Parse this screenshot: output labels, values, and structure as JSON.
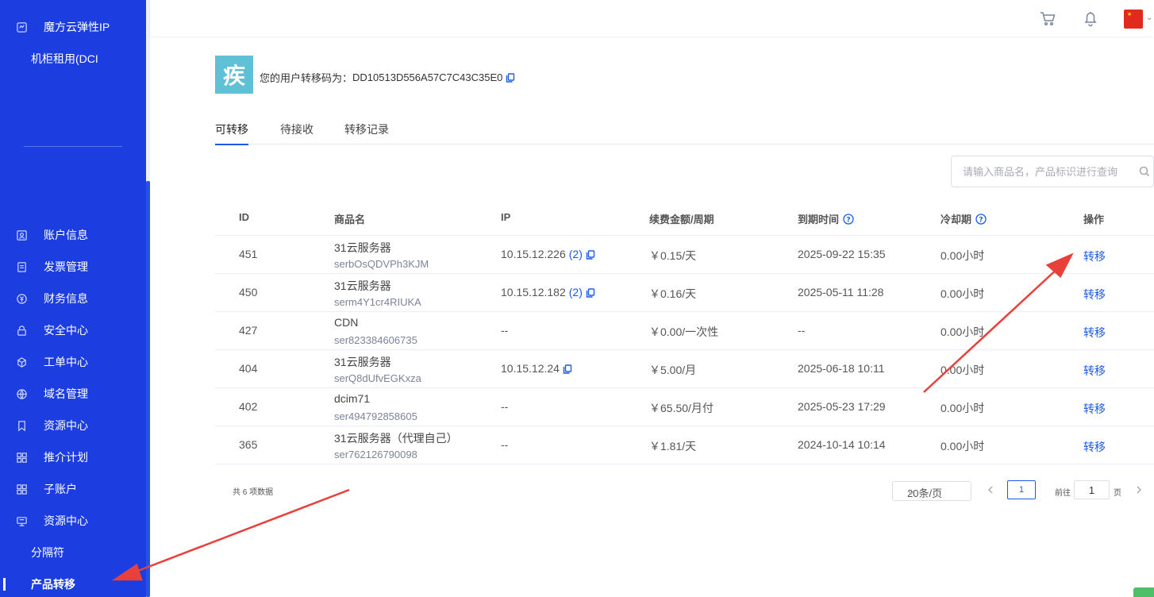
{
  "sidebar": {
    "top_items": [
      {
        "label": "魔方云弹性IP",
        "icon": "cloud-ip-icon"
      },
      {
        "label": "机柜租用(DCI",
        "icon": ""
      }
    ],
    "items": [
      {
        "label": "账户信息",
        "icon": "user-card-icon"
      },
      {
        "label": "发票管理",
        "icon": "invoice-icon"
      },
      {
        "label": "财务信息",
        "icon": "yen-icon"
      },
      {
        "label": "安全中心",
        "icon": "lock-icon"
      },
      {
        "label": "工单中心",
        "icon": "cube-icon"
      },
      {
        "label": "域名管理",
        "icon": "globe-icon"
      },
      {
        "label": "资源中心",
        "icon": "bookmark-icon"
      },
      {
        "label": "推介计划",
        "icon": "grid-icon"
      },
      {
        "label": "子账户",
        "icon": "grid-icon"
      },
      {
        "label": "资源中心",
        "icon": "monitor-icon"
      },
      {
        "label": "分隔符",
        "icon": ""
      },
      {
        "label": "产品转移",
        "icon": "",
        "active": true
      }
    ]
  },
  "user": {
    "avatar_char": "疾",
    "code_label": "您的用户转移码为：",
    "code": "DD10513D556A57C7C43C35E0"
  },
  "tabs": [
    {
      "label": "可转移",
      "active": true
    },
    {
      "label": "待接收"
    },
    {
      "label": "转移记录"
    }
  ],
  "search": {
    "placeholder": "请输入商品名，产品标识进行查询"
  },
  "table": {
    "headers": [
      "ID",
      "商品名",
      "IP",
      "续费金额/周期",
      "到期时间",
      "冷却期",
      "操作"
    ],
    "rows": [
      {
        "id": "451",
        "name": "31云服务器",
        "tag": "serbOsQDVPh3KJM",
        "ip": "10.15.12.226",
        "ip_count": "(2)",
        "amount": "￥0.15/天",
        "expire": "2025-09-22 15:35",
        "cooldown": "0.00小时",
        "action": "转移"
      },
      {
        "id": "450",
        "name": "31云服务器",
        "tag": "serm4Y1cr4RIUKA",
        "ip": "10.15.12.182",
        "ip_count": "(2)",
        "amount": "￥0.16/天",
        "expire": "2025-05-11 11:28",
        "cooldown": "0.00小时",
        "action": "转移"
      },
      {
        "id": "427",
        "name": "CDN",
        "tag": "ser823384606735",
        "ip": "--",
        "ip_count": "",
        "amount": "￥0.00/一次性",
        "expire": "--",
        "cooldown": "0.00小时",
        "action": "转移"
      },
      {
        "id": "404",
        "name": "31云服务器",
        "tag": "serQ8dUfvEGKxza",
        "ip": "10.15.12.24",
        "ip_count": "",
        "amount": "￥5.00/月",
        "expire": "2025-06-18 10:11",
        "cooldown": "0.00小时",
        "action": "转移"
      },
      {
        "id": "402",
        "name": "dcim71",
        "tag": "ser494792858605",
        "ip": "--",
        "ip_count": "",
        "amount": "￥65.50/月付",
        "expire": "2025-05-23 17:29",
        "cooldown": "0.00小时",
        "action": "转移"
      },
      {
        "id": "365",
        "name": "31云服务器（代理自己）",
        "tag": "ser762126790098",
        "ip": "--",
        "ip_count": "",
        "amount": "￥1.81/天",
        "expire": "2024-10-14 10:14",
        "cooldown": "0.00小时",
        "action": "转移"
      }
    ]
  },
  "pagination": {
    "total": "共 6 项数据",
    "page_size": "20条/页",
    "current": "1",
    "goto_label": "前往",
    "goto_value": "1",
    "goto_unit": "页"
  },
  "colors": {
    "sidebar_bg": "#1c3ee0",
    "accent": "#1c5ae6",
    "annotation": "#e8403a",
    "avatar_bg": "#5fc0d6"
  }
}
